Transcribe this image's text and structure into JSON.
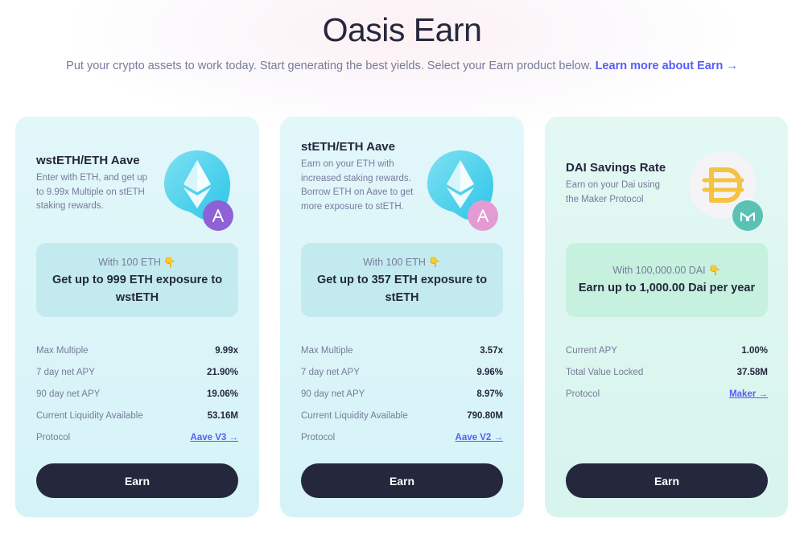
{
  "header": {
    "title": "Oasis Earn",
    "subtitle": "Put your crypto assets to work today. Start generating the best yields. Select your Earn product below.",
    "learn_more": "Learn more about Earn →"
  },
  "cards": [
    {
      "title": "wstETH/ETH Aave",
      "description": "Enter with ETH, and get up to 9.99x Multiple on stETH staking rewards.",
      "logo_icon": "wsteth-token-icon",
      "badge_icon": "aave-protocol-icon",
      "promo_line1": "With 100 ETH 👇",
      "promo_line2": "Get up to 999 ETH exposure to wstETH",
      "stats": [
        {
          "label": "Max Multiple",
          "value": "9.99x"
        },
        {
          "label": "7 day net APY",
          "value": "21.90%"
        },
        {
          "label": "90 day net APY",
          "value": "19.06%"
        },
        {
          "label": "Current Liquidity Available",
          "value": "53.16M"
        },
        {
          "label": "Protocol",
          "value": "Aave V3 →"
        }
      ],
      "button": "Earn"
    },
    {
      "title": "stETH/ETH Aave",
      "description": "Earn on your ETH with increased staking rewards. Borrow ETH on Aave to get more exposure to stETH.",
      "logo_icon": "steth-token-icon",
      "badge_icon": "aave-protocol-icon",
      "promo_line1": "With 100 ETH 👇",
      "promo_line2": "Get up to 357 ETH exposure to stETH",
      "stats": [
        {
          "label": "Max Multiple",
          "value": "3.57x"
        },
        {
          "label": "7 day net APY",
          "value": "9.96%"
        },
        {
          "label": "90 day net APY",
          "value": "8.97%"
        },
        {
          "label": "Current Liquidity Available",
          "value": "790.80M"
        },
        {
          "label": "Protocol",
          "value": "Aave V2 →"
        }
      ],
      "button": "Earn"
    },
    {
      "title": "DAI Savings Rate",
      "description": "Earn on your Dai using the Maker Protocol",
      "logo_icon": "dai-token-icon",
      "badge_icon": "maker-protocol-icon",
      "promo_line1": "With 100,000.00 DAI 👇",
      "promo_line2": "Earn up to 1,000.00 Dai per year",
      "stats": [
        {
          "label": "Current APY",
          "value": "1.00%"
        },
        {
          "label": "Total Value Locked",
          "value": "37.58M"
        },
        {
          "label": "Protocol",
          "value": "Maker →"
        }
      ],
      "button": "Earn"
    }
  ],
  "colors": {
    "accent": "#575cfe",
    "dark": "#25273d",
    "muted": "#787a9b",
    "aave_badge_strong": "#8e62d6",
    "aave_badge_soft": "#e49bd3",
    "maker_badge": "#5ac2b3",
    "dai_gold": "#f5c341"
  }
}
